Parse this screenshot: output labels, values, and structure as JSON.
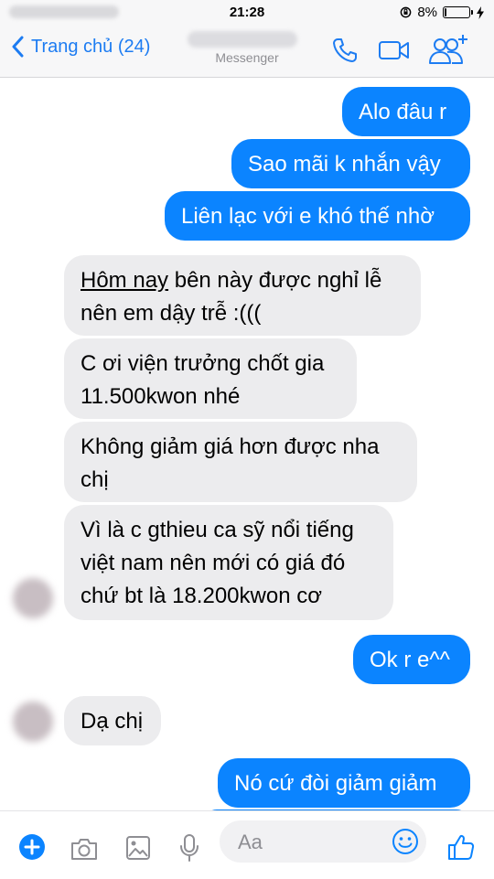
{
  "status": {
    "time": "21:28",
    "battery": "8%",
    "battery_level": 0.08
  },
  "header": {
    "back_label": "Trang chủ (24)",
    "subtitle": "Messenger"
  },
  "messages": [
    {
      "side": "out",
      "text": "Alo đâu r"
    },
    {
      "side": "out",
      "text": "Sao mãi k nhắn vậy"
    },
    {
      "side": "out",
      "text": "Liên lạc với e khó thế nhờ"
    },
    {
      "side": "in",
      "underline": "Hôm nay",
      "line1_rest": " bên này được nghỉ lễ",
      "line2": "nên em dậy trễ :((("
    },
    {
      "side": "in",
      "line1": "C ơi viện trưởng chốt gia",
      "line2": "11.500kwon nhé"
    },
    {
      "side": "in",
      "line1": "Không giảm giá hơn được nha",
      "line2": "chị"
    },
    {
      "side": "in",
      "line1": "Vì là c gthieu ca sỹ nổi tiếng",
      "line2": "việt nam nên mới có giá đó",
      "line3": "chứ bt là 18.200kwon cơ"
    },
    {
      "side": "out",
      "text": "Ok r e^^"
    },
    {
      "side": "in",
      "text": "Dạ chị"
    },
    {
      "side": "out",
      "text": "Nó cứ đòi giảm giảm"
    }
  ],
  "composer": {
    "placeholder": "Aa"
  },
  "colors": {
    "accent": "#0b84ff",
    "incoming": "#ececee",
    "nav_blue": "#1d7cf2"
  }
}
